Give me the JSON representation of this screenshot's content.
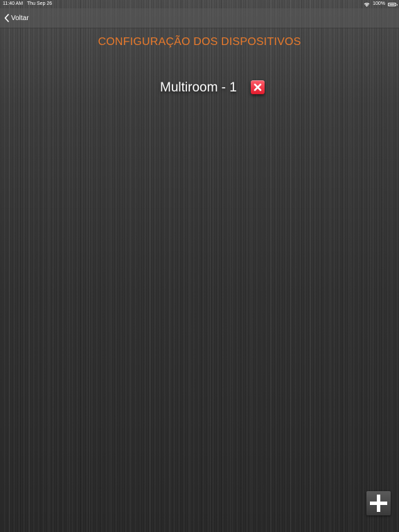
{
  "status_bar": {
    "time": "11:40 AM",
    "date": "Thu Sep 26",
    "battery": "100%",
    "icons": [
      "wifi-icon",
      "battery-icon"
    ]
  },
  "nav": {
    "back_label": "Voltar",
    "back_icon": "chevron-left-icon"
  },
  "page": {
    "title": "CONFIGURAÇÃO DOS DISPOSITIVOS",
    "title_color": "#e87a2c"
  },
  "devices": [
    {
      "label": "Multiroom - 1",
      "delete_icon": "close-icon"
    }
  ],
  "actions": {
    "add_icon": "plus-icon"
  },
  "colors": {
    "delete_red": "#e21b2c",
    "text_white": "#ffffff"
  }
}
